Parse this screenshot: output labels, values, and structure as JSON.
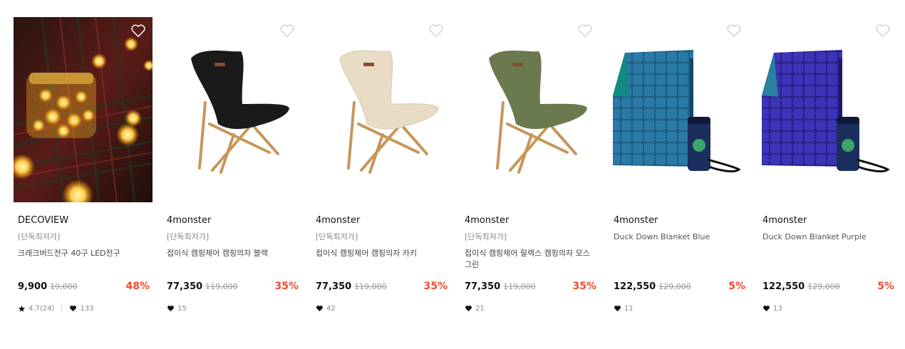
{
  "products": [
    {
      "brand": "DECOVIEW",
      "tag": "[단독최저가]",
      "name": "크래크버드전구 40구 LED전구",
      "price": "9,900",
      "original_price": "19,000",
      "discount": "48%",
      "rating": "4.7(24)",
      "likes": "133",
      "image_icon": "led-jar-image",
      "wishlist_icon": "heart-outline-icon"
    },
    {
      "brand": "4monster",
      "tag": "[단독최저가]",
      "name": "접이식 캠핑체어 캠핑의자 블랙",
      "price": "77,350",
      "original_price": "119,000",
      "discount": "35%",
      "likes": "15",
      "image_icon": "black-chair-image",
      "color": "#1a1a1a",
      "wishlist_icon": "heart-outline-icon"
    },
    {
      "brand": "4monster",
      "tag": "[단독최저가]",
      "name": "접이식 캠핑체어 캠핑의자 카키",
      "price": "77,350",
      "original_price": "119,000",
      "discount": "35%",
      "likes": "42",
      "image_icon": "beige-chair-image",
      "color": "#e9dcc6",
      "wishlist_icon": "heart-outline-icon"
    },
    {
      "brand": "4monster",
      "tag": "[단독최저가]",
      "name": "접이식 캠핑체어 릴렉스 캠핑의자 모스그린",
      "price": "77,350",
      "original_price": "119,000",
      "discount": "35%",
      "likes": "21",
      "image_icon": "green-chair-image",
      "color": "#6b7a4e",
      "wishlist_icon": "heart-outline-icon"
    },
    {
      "brand": "4monster",
      "tag": "",
      "name": "Duck Down Blanket Blue",
      "price": "122,550",
      "original_price": "129,000",
      "discount": "5%",
      "likes": "11",
      "image_icon": "blue-blanket-image",
      "color": "#1f5f85",
      "wishlist_icon": "heart-outline-icon"
    },
    {
      "brand": "4monster",
      "tag": "",
      "name": "Duck Down Blanket Purple",
      "price": "122,550",
      "original_price": "129,000",
      "discount": "5%",
      "likes": "13",
      "image_icon": "purple-blanket-image",
      "color": "#3a2fa0",
      "wishlist_icon": "heart-outline-icon"
    }
  ],
  "accent_color": "#ef4b2d"
}
